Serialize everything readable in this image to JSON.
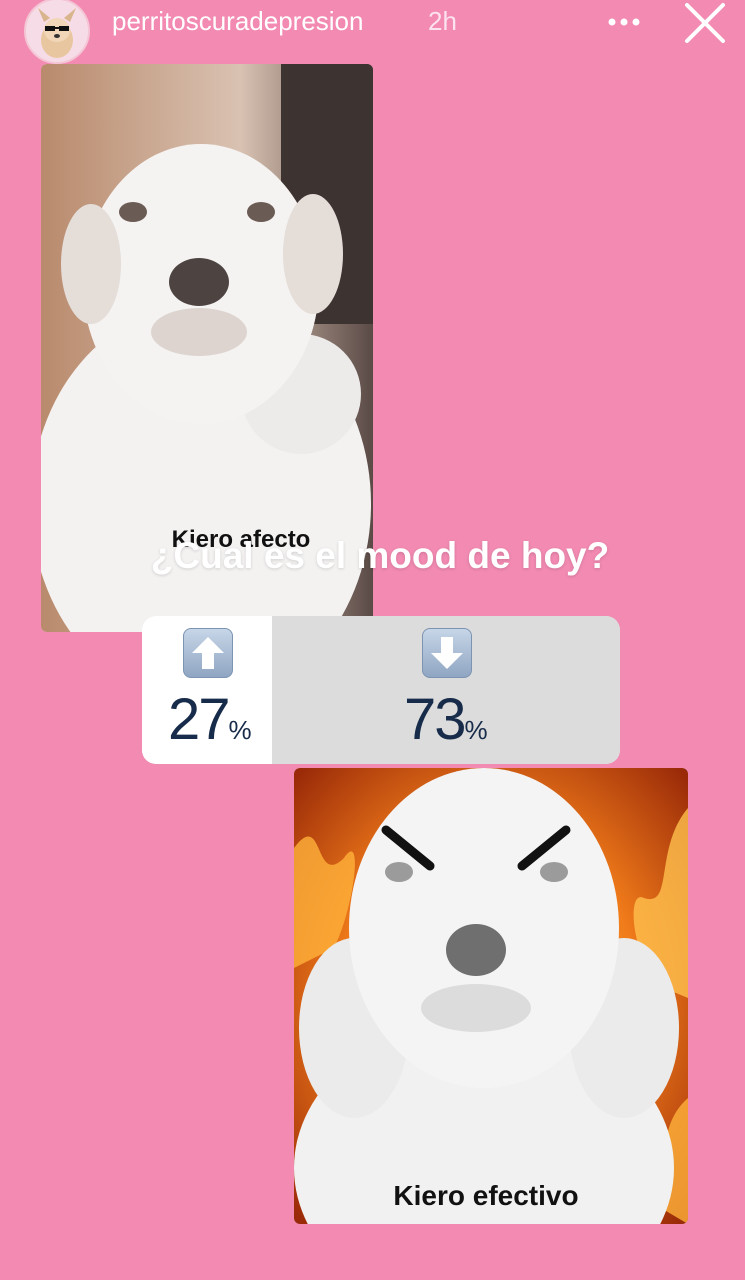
{
  "header": {
    "username": "perritoscuradepresion",
    "time": "2h",
    "more_icon": "more-horizontal-icon",
    "close_icon": "close-icon"
  },
  "stickers": {
    "top_caption": "Kiero afecto",
    "bottom_caption": "Kiero efectivo"
  },
  "poll": {
    "question": "¿Cual es el mood de hoy?",
    "options": [
      {
        "icon": "arrow-up-emoji",
        "percent": "27",
        "sign": "%"
      },
      {
        "icon": "arrow-down-emoji",
        "percent": "73",
        "sign": "%"
      }
    ]
  }
}
